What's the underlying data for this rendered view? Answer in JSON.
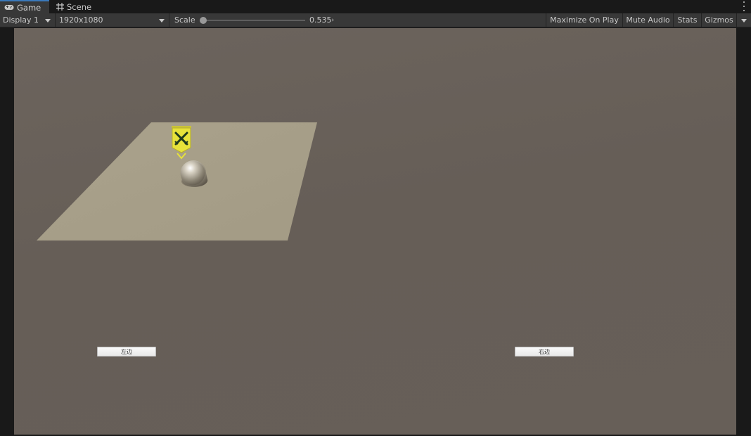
{
  "tabs": [
    {
      "label": "Game",
      "icon": "gamepad-icon",
      "active": true
    },
    {
      "label": "Scene",
      "icon": "grid-icon",
      "active": false
    }
  ],
  "toolbar": {
    "display": "Display 1",
    "resolution": "1920x1080",
    "scale_label": "Scale",
    "scale_value": "0.535",
    "scale_fraction": 0.0,
    "maximize_on_play": "Maximize On Play",
    "mute_audio": "Mute Audio",
    "stats": "Stats",
    "gizmos": "Gizmos"
  },
  "game": {
    "left_button": "左边",
    "right_button": "右边",
    "background_color": "#675f58",
    "plane_color": "#a69e88",
    "banner_color": "#e7e23a"
  },
  "colors": {
    "accent": "#3a79bb",
    "panel": "#383838",
    "dark": "#191919"
  }
}
